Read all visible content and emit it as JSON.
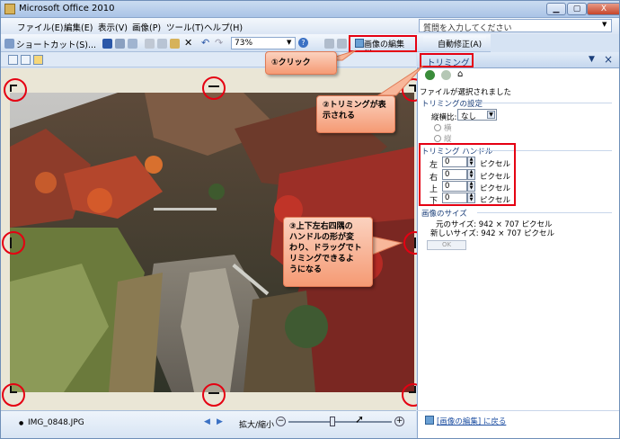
{
  "window": {
    "title": "Microsoft Office 2010",
    "min": "▁",
    "max": "▢",
    "close": "X"
  },
  "menu": [
    "ファイル(E)",
    "編集(E)",
    "表示(V)",
    "画像(P)",
    "ツール(T)",
    "ヘルプ(H)"
  ],
  "help_placeholder": "質問を入力してください",
  "toolbar": {
    "shortcut_label": "ショートカット(S)...",
    "zoom_value": "73%",
    "edit_image_label": "画像の編集(I)...",
    "auto_fix_label": "自動修正(A)"
  },
  "pane": {
    "title": "トリミング",
    "no_file": "ファイルが選択されました",
    "section_trim_settings": "トリミングの設定",
    "aspect_label": "縦横比:",
    "aspect_value": "なし",
    "radio_landscape": "横",
    "radio_portrait": "縦",
    "section_handles": "トリミング ハンドル",
    "handles": [
      {
        "label": "左",
        "value": "0",
        "unit": "ピクセル"
      },
      {
        "label": "右",
        "value": "0",
        "unit": "ピクセル"
      },
      {
        "label": "上",
        "value": "0",
        "unit": "ピクセル"
      },
      {
        "label": "下",
        "value": "0",
        "unit": "ピクセル"
      }
    ],
    "section_image_size": "画像のサイズ",
    "original_size": "元のサイズ: 942 × 707 ピクセル",
    "new_size": "新しいサイズ: 942 × 707 ピクセル",
    "ok_label": "OK",
    "back_link": "[画像の編集] に戻る"
  },
  "status": {
    "filename": "IMG_0848.JPG",
    "zoom_label": "拡大/縮小",
    "zoom_minus": "−",
    "zoom_plus": "+"
  },
  "callouts": {
    "click": "①クリック",
    "trim_shown_1": "②トリミングが表",
    "trim_shown_2": "示される",
    "handles_1": "③上下左右四隅の",
    "handles_2": "ハンドルの形が変",
    "handles_3": "わり、ドラッグでト",
    "handles_4": "リミングできるよ",
    "handles_5": "うになる"
  },
  "colors": {
    "annotation_red": "#e50012",
    "callout_fill": "#f59a74",
    "pane_title": "#1b3f7a"
  }
}
